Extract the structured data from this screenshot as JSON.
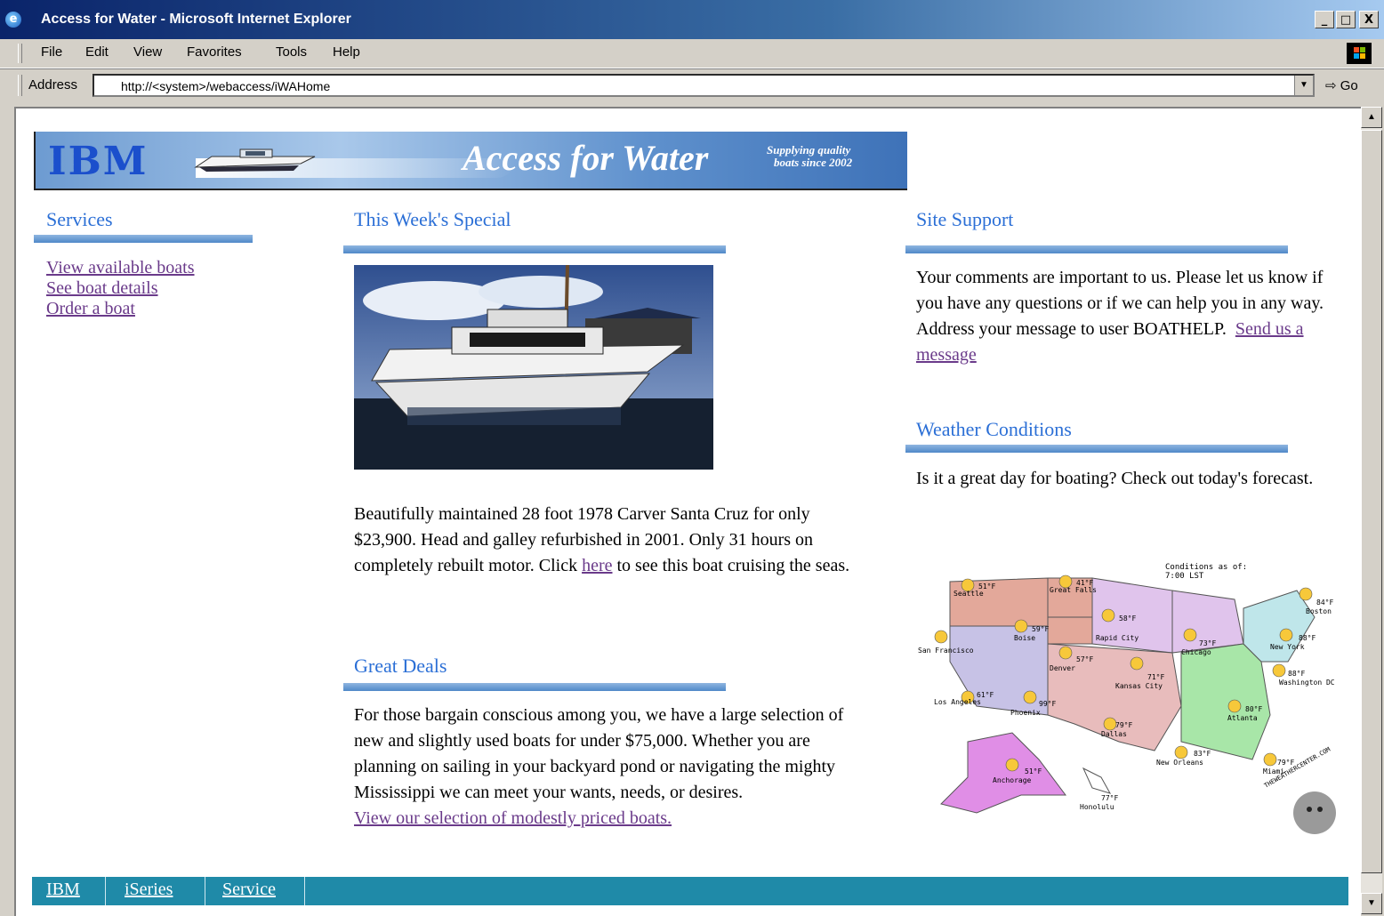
{
  "window": {
    "title": "Access for Water - Microsoft Internet Explorer",
    "minimize_label": "_",
    "maximize_label": "□",
    "close_label": "X"
  },
  "menu": {
    "items": [
      "File",
      "Edit",
      "View",
      "Favorites",
      "Tools",
      "Help"
    ]
  },
  "address": {
    "label": "Address",
    "url": "http://<system>/webaccess/iWAHome",
    "go_label": "Go"
  },
  "banner": {
    "logo": "IBM",
    "brand": "Access for Water",
    "tagline_line1": "Supplying quality",
    "tagline_line2": "boats since 2002"
  },
  "services": {
    "heading": "Services",
    "links": [
      "View available boats",
      "See boat details",
      "Order a boat"
    ]
  },
  "special": {
    "heading": "This Week's Special",
    "text_before_link": "Beautifully maintained 28 foot 1978 Carver Santa Cruz for only $23,900. Head and galley refurbished in 2001. Only 31 hours on completely rebuilt motor. Click ",
    "link": "here",
    "text_after_link": " to see this boat cruising the seas."
  },
  "deals": {
    "heading": "Great Deals",
    "text": "For those bargain conscious among you, we have a large selection of new and slightly used boats for under $75,000. Whether you are planning on sailing in your backyard pond or navigating the mighty Mississippi we can meet your wants, needs, or desires.",
    "link": "View our selection of modestly priced boats."
  },
  "support": {
    "heading": "Site Support",
    "text": "Your comments are important to us. Please let us know if you have any questions or if we can help you in any way. Address your message to user BOATHELP.",
    "link": "Send us a message"
  },
  "weather": {
    "heading": "Weather Conditions",
    "text": "Is it a great day for boating? Check out today's forecast.",
    "map_caption_line1": "Conditions as of:",
    "map_caption_line2": "7:00 LST",
    "cities": [
      {
        "name": "Seattle",
        "temp": "51°F"
      },
      {
        "name": "Great Falls",
        "temp": "41°F"
      },
      {
        "name": "Boise",
        "temp": "59°F"
      },
      {
        "name": "Rapid City",
        "temp": "58°F"
      },
      {
        "name": "Chicago",
        "temp": "73°F"
      },
      {
        "name": "Boston",
        "temp": "84°F"
      },
      {
        "name": "New York",
        "temp": "88°F"
      },
      {
        "name": "San Francisco",
        "temp": ""
      },
      {
        "name": "Denver",
        "temp": "57°F"
      },
      {
        "name": "Kansas City",
        "temp": "71°F"
      },
      {
        "name": "Washington DC",
        "temp": "88°F"
      },
      {
        "name": "Los Angeles",
        "temp": "61°F"
      },
      {
        "name": "Phoenix",
        "temp": "99°F"
      },
      {
        "name": "Dallas",
        "temp": "79°F"
      },
      {
        "name": "Atlanta",
        "temp": "80°F"
      },
      {
        "name": "New Orleans",
        "temp": "83°F"
      },
      {
        "name": "Miami",
        "temp": "79°F"
      },
      {
        "name": "Anchorage",
        "temp": "51°F"
      },
      {
        "name": "Honolulu",
        "temp": "77°F"
      }
    ],
    "watermark": "THEWEATHERCENTER.COM"
  },
  "footer": {
    "links": [
      "IBM",
      "iSeries",
      "Service"
    ]
  }
}
